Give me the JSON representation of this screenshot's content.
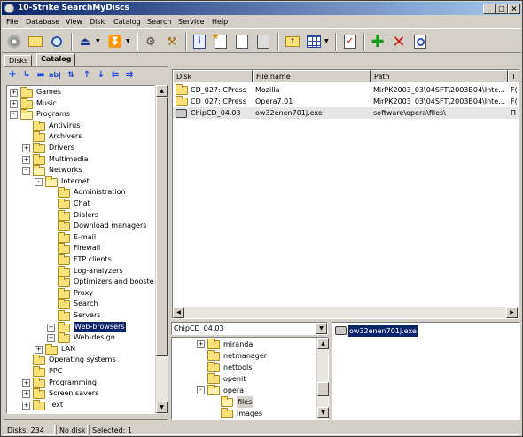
{
  "window": {
    "title": "10-Strike SearchMyDiscs"
  },
  "menu": [
    "File",
    "Database",
    "View",
    "Disk",
    "Catalog",
    "Search",
    "Service",
    "Help"
  ],
  "toolbar": {
    "buttons": [
      "disc-icon",
      "folder-open-icon",
      "search-icon",
      "eject-icon",
      "load-icon",
      "scan-icon",
      "tools-icon",
      "info-icon",
      "add-page-icon",
      "copy-page-icon",
      "save-icon",
      "folder-up-icon",
      "view-grid-icon",
      "checklist-icon",
      "add-icon",
      "delete-icon",
      "report-icon"
    ]
  },
  "tabs": [
    "Disks",
    "Catalog"
  ],
  "tree": [
    {
      "label": "Games",
      "level": 0,
      "exp": "+"
    },
    {
      "label": "Music",
      "level": 0,
      "exp": "+"
    },
    {
      "label": "Programs",
      "level": 0,
      "exp": "-"
    },
    {
      "label": "Antivirus",
      "level": 1,
      "exp": ""
    },
    {
      "label": "Archivers",
      "level": 1,
      "exp": ""
    },
    {
      "label": "Drivers",
      "level": 1,
      "exp": "+"
    },
    {
      "label": "Multimedia",
      "level": 1,
      "exp": "+"
    },
    {
      "label": "Networks",
      "level": 1,
      "exp": "-"
    },
    {
      "label": "Internet",
      "level": 2,
      "exp": "-"
    },
    {
      "label": "Administration",
      "level": 3,
      "exp": ""
    },
    {
      "label": "Chat",
      "level": 3,
      "exp": ""
    },
    {
      "label": "Dialers",
      "level": 3,
      "exp": ""
    },
    {
      "label": "Download managers",
      "level": 3,
      "exp": ""
    },
    {
      "label": "E-mail",
      "level": 3,
      "exp": ""
    },
    {
      "label": "Firewall",
      "level": 3,
      "exp": ""
    },
    {
      "label": "FTP clients",
      "level": 3,
      "exp": ""
    },
    {
      "label": "Log-analyzers",
      "level": 3,
      "exp": ""
    },
    {
      "label": "Optimizers and boosters",
      "level": 3,
      "exp": ""
    },
    {
      "label": "Proxy",
      "level": 3,
      "exp": ""
    },
    {
      "label": "Search",
      "level": 3,
      "exp": ""
    },
    {
      "label": "Servers",
      "level": 3,
      "exp": ""
    },
    {
      "label": "Web-browsers",
      "level": 3,
      "exp": "+",
      "selected": true
    },
    {
      "label": "Web-design",
      "level": 3,
      "exp": "+"
    },
    {
      "label": "LAN",
      "level": 2,
      "exp": "+"
    },
    {
      "label": "Operating systems",
      "level": 1,
      "exp": ""
    },
    {
      "label": "PPC",
      "level": 1,
      "exp": ""
    },
    {
      "label": "Programming",
      "level": 1,
      "exp": "+"
    },
    {
      "label": "Screen savers",
      "level": 1,
      "exp": "+"
    },
    {
      "label": "Text",
      "level": 1,
      "exp": "+"
    }
  ],
  "grid": {
    "columns": [
      "Disk",
      "File name",
      "Path",
      "T"
    ],
    "rows": [
      {
        "icon": "folder",
        "disk": "CD_027: CPress",
        "file": "Mozilla",
        "path": "MirPK2003_03\\04SFT\\2003B04\\Inte...",
        "t": "F("
      },
      {
        "icon": "folder",
        "disk": "CD_027: CPress",
        "file": "Opera7.01",
        "path": "MirPK2003_03\\04SFT\\2003B04\\Inte...",
        "t": "F("
      },
      {
        "icon": "exe",
        "disk": "ChipCD_04.03",
        "file": "ow32enen701j.exe",
        "path": "software\\opera\\files\\",
        "t": "П"
      }
    ]
  },
  "disk_combo": {
    "value": "ChipCD_04.03"
  },
  "disk_tree": [
    {
      "label": "miranda",
      "level": 0,
      "exp": "+"
    },
    {
      "label": "netmanager",
      "level": 0,
      "exp": ""
    },
    {
      "label": "nettools",
      "level": 0,
      "exp": ""
    },
    {
      "label": "openit",
      "level": 0,
      "exp": ""
    },
    {
      "label": "opera",
      "level": 0,
      "exp": "-"
    },
    {
      "label": "files",
      "level": 1,
      "exp": "",
      "selected": true
    },
    {
      "label": "images",
      "level": 1,
      "exp": ""
    }
  ],
  "files_list": [
    {
      "label": "ow32enen701j.exe",
      "selected": true
    }
  ],
  "status": {
    "disks": "Disks: 234",
    "disk": "No disk",
    "selected": "Selected: 1"
  }
}
